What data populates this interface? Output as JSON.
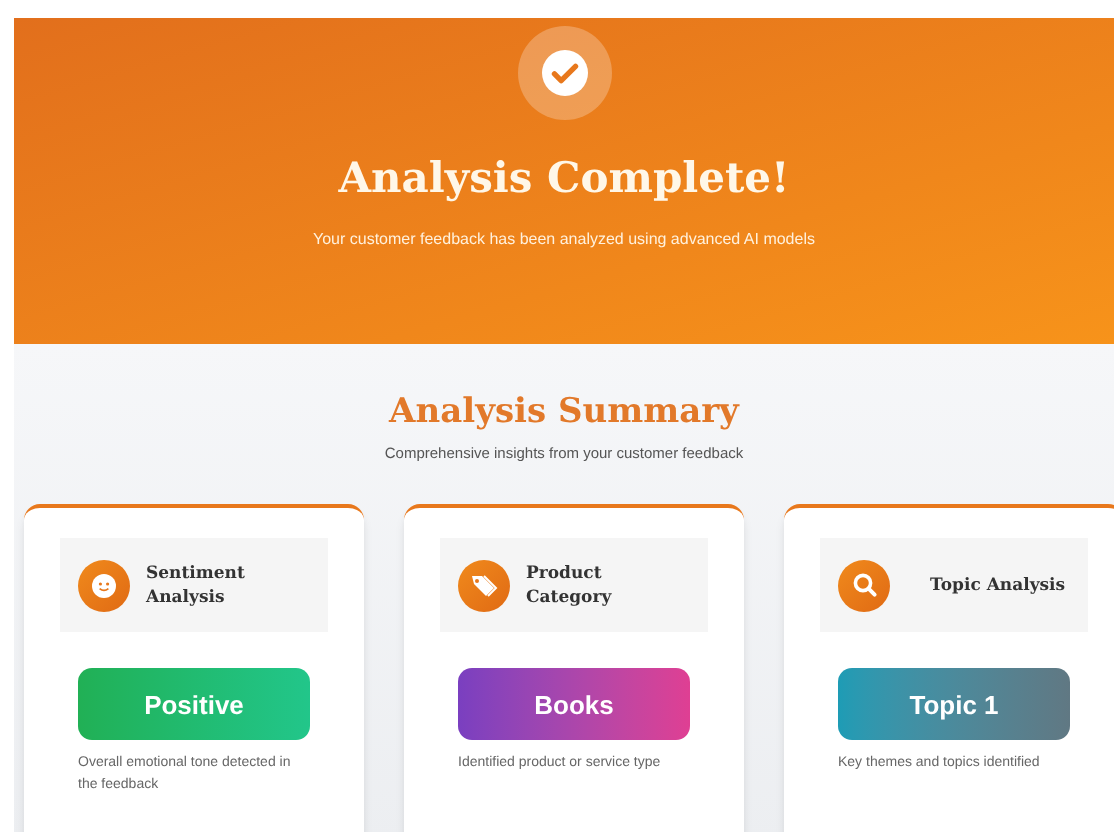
{
  "hero": {
    "title": "Analysis Complete!",
    "subtitle": "Your customer feedback has been analyzed using advanced AI models"
  },
  "summary": {
    "title": "Analysis Summary",
    "subtitle": "Comprehensive insights from your customer feedback"
  },
  "cards": [
    {
      "kind": "sentiment",
      "title": "Sentiment Analysis",
      "value": "Positive",
      "description": "Overall emotional tone detected in the feedback"
    },
    {
      "kind": "category",
      "title": "Product Category",
      "value": "Books",
      "description": "Identified product or service type"
    },
    {
      "kind": "topic",
      "title": "Topic Analysis",
      "value": "Topic 1",
      "description": "Key themes and topics identified"
    }
  ]
}
